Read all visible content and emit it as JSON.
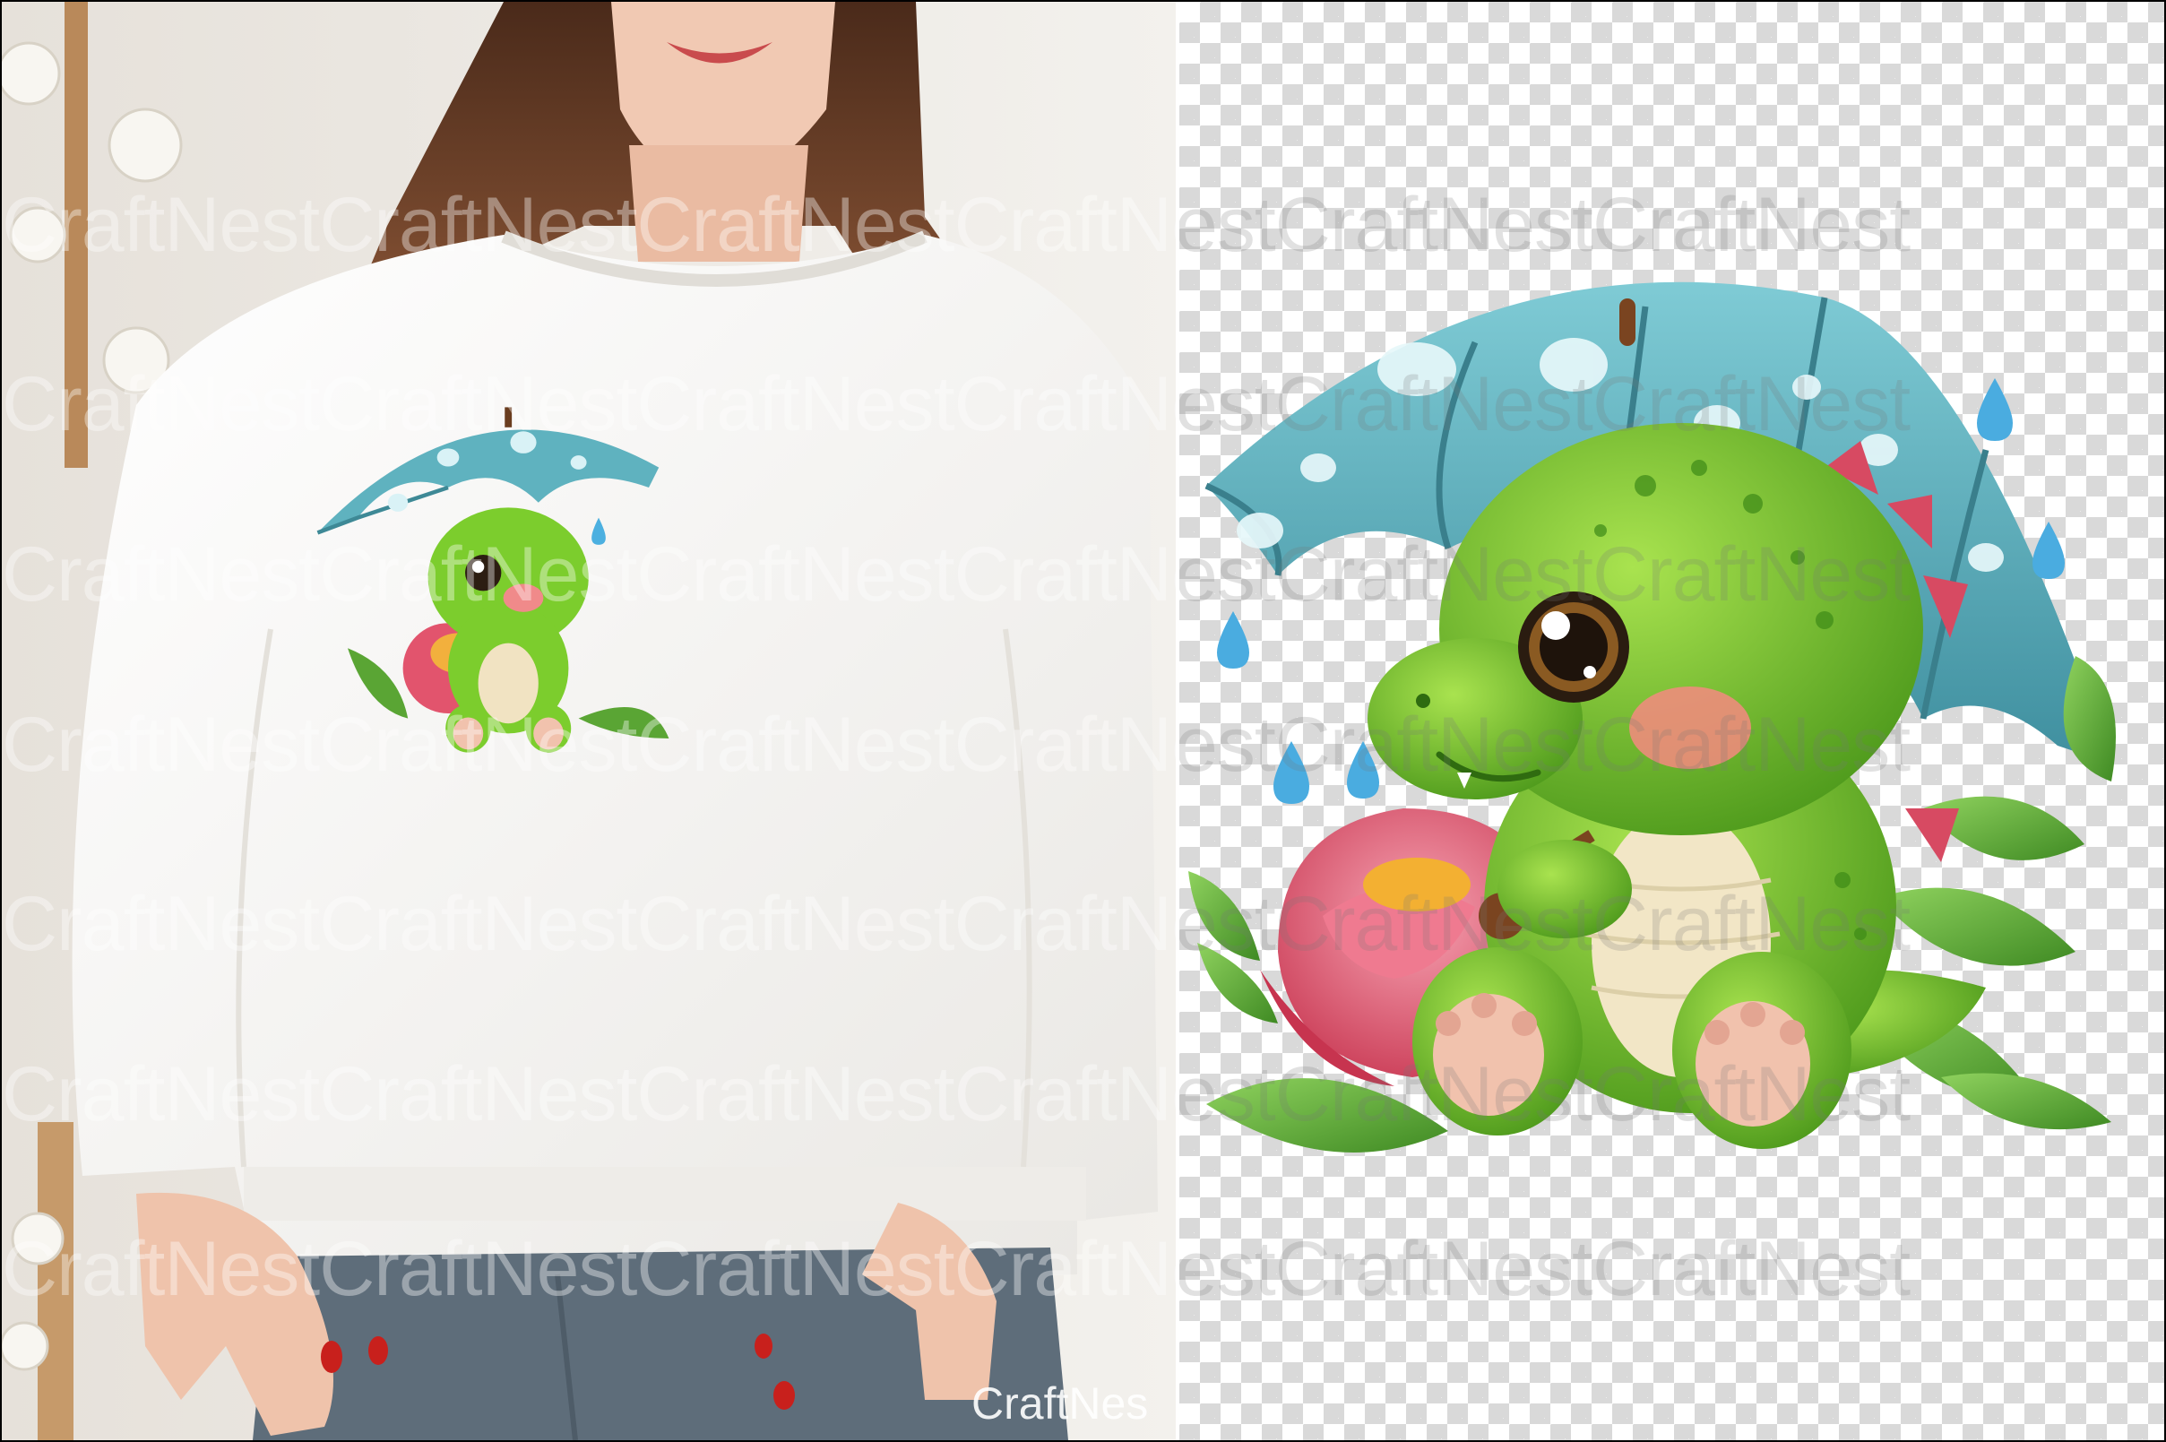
{
  "watermark": {
    "text": "CraftNestCraftNestCraftNestCraftNestCraftNestCraftNest",
    "bottom_text": "CraftNes"
  },
  "colors": {
    "sweater": "#f7f6f4",
    "skin": "#f1c9b3",
    "hair": "#5a3522",
    "jeans": "#5e6d7a",
    "umbrella": "#5fb2bf",
    "dino": "#7ccd2d",
    "flower": "#e2546d",
    "leaf": "#5aa534",
    "nails": "#c8201c"
  }
}
